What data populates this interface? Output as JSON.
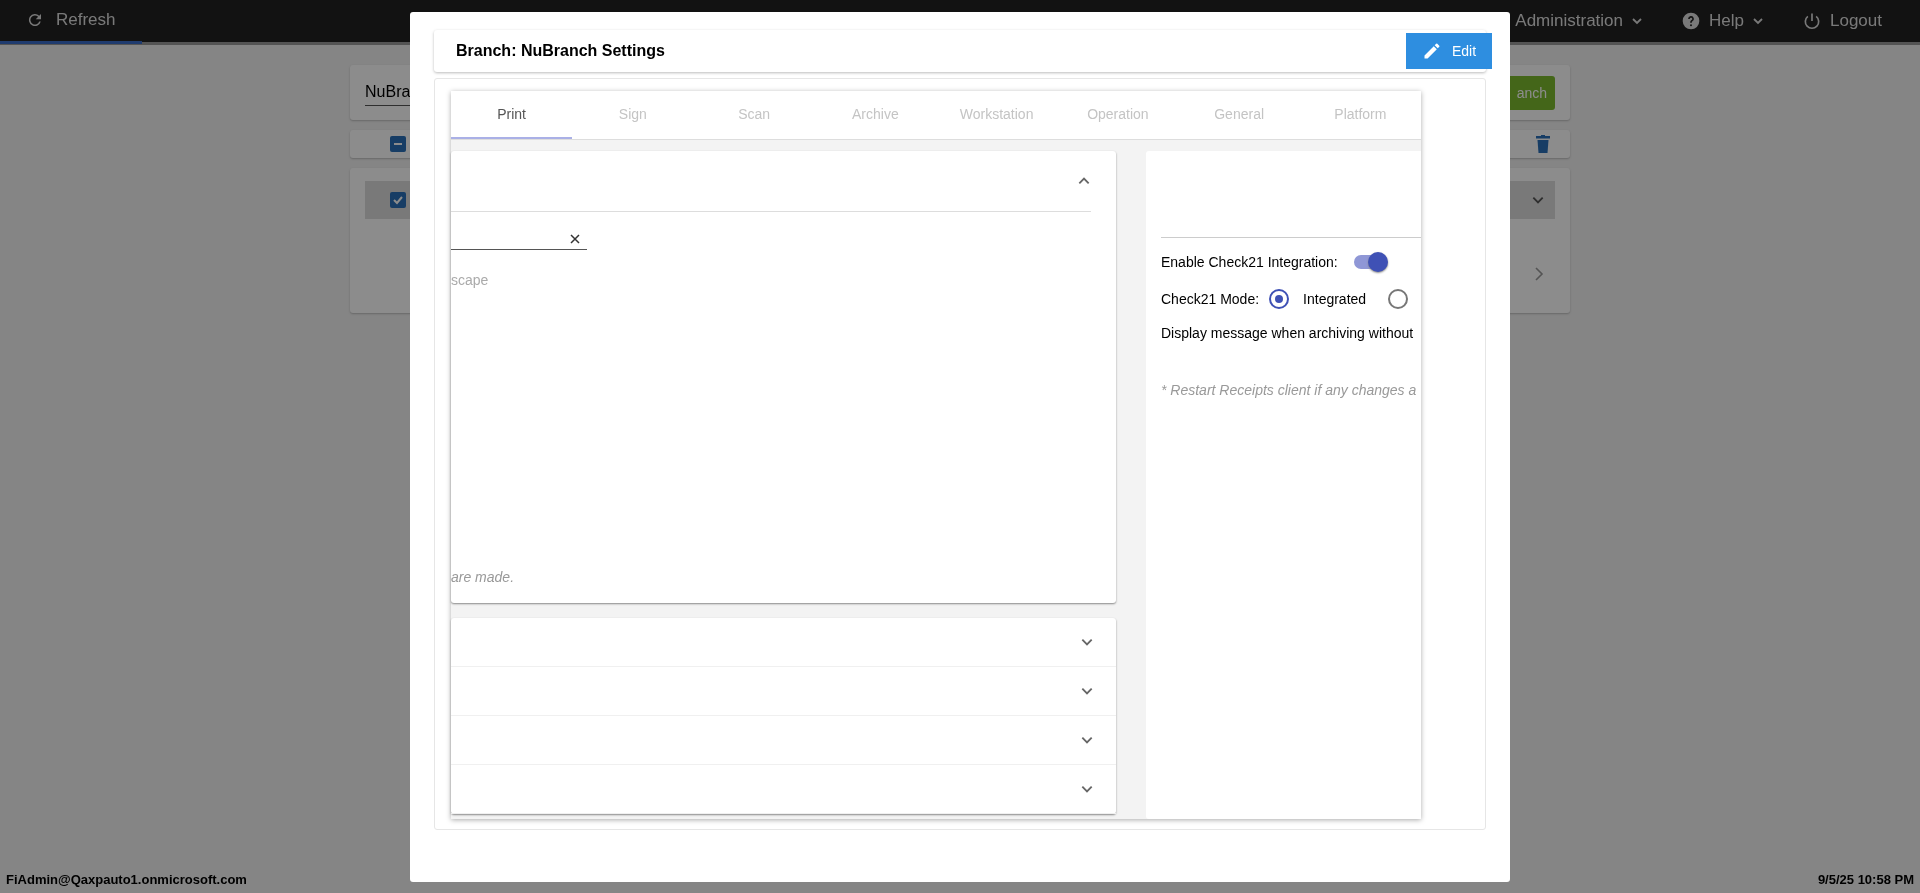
{
  "top_bar": {
    "refresh": "Refresh",
    "menus": [
      {
        "label": "Administration",
        "kind": "plain",
        "dropdown": true
      },
      {
        "label": "Help",
        "kind": "help",
        "dropdown": true
      },
      {
        "label": "Logout",
        "kind": "logout",
        "dropdown": false
      }
    ]
  },
  "background": {
    "name_field_value": "NuBra",
    "add_button": "anch",
    "header_checkbox_indeterminate": true,
    "row_checkbox_checked": true
  },
  "modal": {
    "title": "Branch: NuBranch Settings",
    "edit_button": "Edit",
    "tabs": [
      {
        "label": "Print",
        "selected": true
      },
      {
        "label": "Sign",
        "selected": false
      },
      {
        "label": "Scan",
        "selected": false
      },
      {
        "label": "Archive",
        "selected": false
      },
      {
        "label": "Workstation",
        "selected": false
      },
      {
        "label": "Operation",
        "selected": false
      },
      {
        "label": "General",
        "selected": false
      },
      {
        "label": "Platform",
        "selected": false
      }
    ],
    "left_panel": {
      "expanded": true,
      "orientation_hint": "scape",
      "note": "are made."
    },
    "sections": [
      {
        "expanded": false
      },
      {
        "expanded": false
      },
      {
        "expanded": false
      },
      {
        "expanded": false
      }
    ],
    "right_panel": {
      "toggle_label": "Enable Check21 Integration:",
      "toggle_on": true,
      "mode_label": "Check21 Mode:",
      "modes": [
        {
          "label": "Integrated",
          "selected": true
        },
        {
          "selected": false
        }
      ],
      "message_label": "Display message when archiving without",
      "note": "* Restart Receipts client if any changes a"
    }
  },
  "status_bar": {
    "user": "FiAdmin@Qaxpauto1.onmicrosoft.com",
    "datetime": "9/5/25 10:58 PM"
  }
}
